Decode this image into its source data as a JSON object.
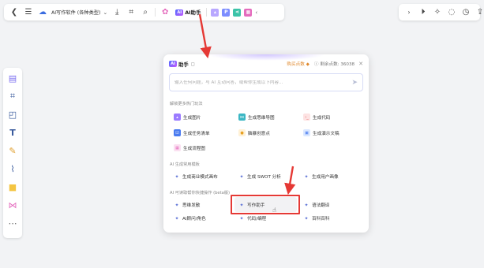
{
  "toolbar": {
    "doc_title": "AI写作软件 (各种类型)",
    "ai_label": "AI助手",
    "ai_logo": "AI",
    "tools": [
      {
        "icon": "image-icon",
        "color": "#b8a7ff",
        "text": ""
      },
      {
        "icon": "p-icon",
        "color": "#7b8cff",
        "text": "P"
      },
      {
        "icon": "share-icon",
        "color": "#3cc3a8",
        "text": ""
      },
      {
        "icon": "flow-icon",
        "color": "#e46bbd",
        "text": ""
      }
    ]
  },
  "panel": {
    "title": "助手",
    "buy_label": "购买点数",
    "remaining_label": "剩余点数: 36038",
    "ask_placeholder": "输入任何问题，与 AI 互动问答，或帮你生成以下内容...",
    "section_explore": "解锁更多热门玩法",
    "explore_items": [
      {
        "label": "生成图片",
        "color": "#9b7bff"
      },
      {
        "label": "生成思维导图",
        "color": "#3cb7c4"
      },
      {
        "label": "生成代码",
        "color": "#f07474"
      },
      {
        "label": "生成任务清单",
        "color": "#4a7bf0"
      },
      {
        "label": "脑暴创意点",
        "color": "#f4b740"
      },
      {
        "label": "生成演示文稿",
        "color": "#5b9bf0"
      },
      {
        "label": "生成流程图",
        "color": "#e46bbd"
      }
    ],
    "section_template": "AI 生成常用模板",
    "template_items": [
      "生成商业模式画布",
      "生成 SWOT 分析",
      "生成用户画像"
    ],
    "section_quick": "AI 可读取帮你快捷操作 (beta版)",
    "quick_items": [
      "思维发散",
      "写作助手",
      "语法翻译",
      "AI顾问/角色",
      "代码/编程",
      "百科百科"
    ]
  },
  "colors": {
    "accent": "#5a6fd6",
    "highlight": "#e53935",
    "buy": "#e0892e"
  }
}
